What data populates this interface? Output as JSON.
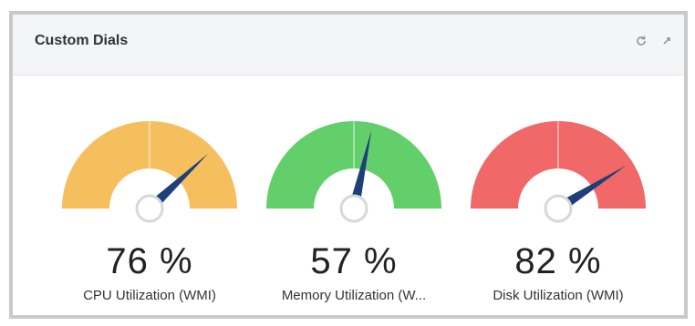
{
  "widget": {
    "title": "Custom Dials",
    "tools": [
      {
        "icon": "refresh-icon"
      },
      {
        "icon": "expand-icon"
      }
    ]
  },
  "dials": [
    {
      "value": 76,
      "value_text": "76 %",
      "label": "CPU Utilization (WMI)",
      "color": "#f6bf5e"
    },
    {
      "value": 57,
      "value_text": "57 %",
      "label": "Memory Utilization (W...",
      "color": "#62cf6a"
    },
    {
      "value": 82,
      "value_text": "82 %",
      "label": "Disk Utilization (WMI)",
      "color": "#f06868"
    }
  ],
  "colors": {
    "needle": "#1f3f7a",
    "hub_ring": "#d6d8da"
  }
}
